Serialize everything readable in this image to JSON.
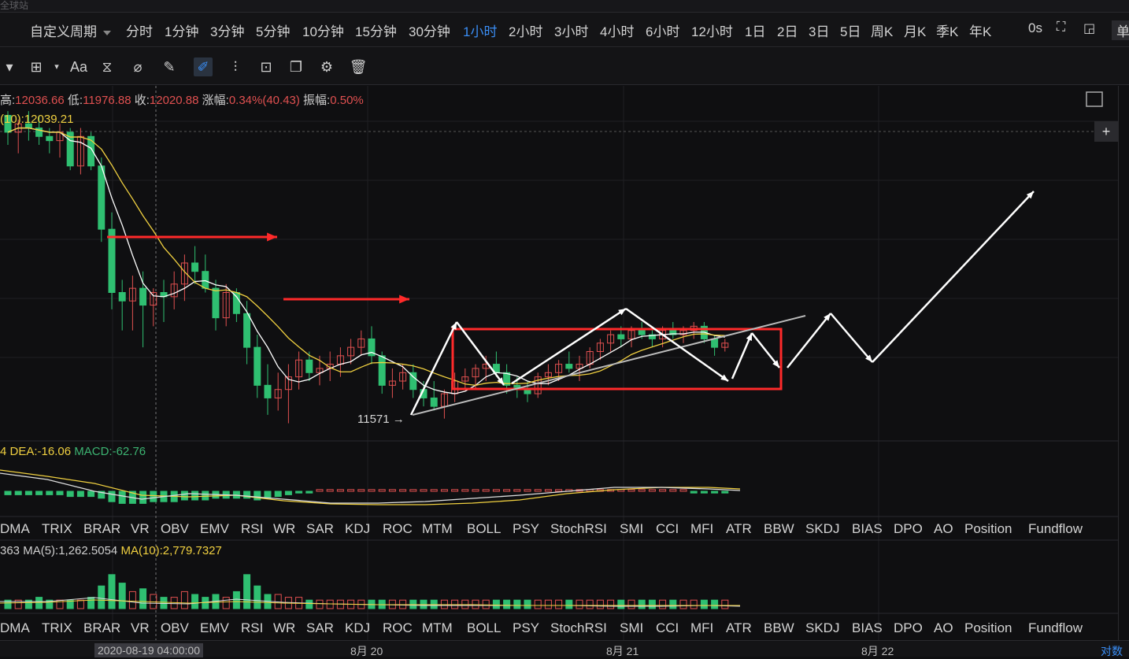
{
  "top_strip": {
    "text": "全球站"
  },
  "period_bar": {
    "custom_label": "自定义周期",
    "periods": [
      "分时",
      "1分钟",
      "3分钟",
      "5分钟",
      "10分钟",
      "15分钟",
      "30分钟",
      "1小时",
      "2小时",
      "3小时",
      "4小时",
      "6小时",
      "12小时",
      "1日",
      "2日",
      "3日",
      "5日",
      "周K",
      "月K",
      "季K",
      "年K"
    ],
    "active_period": "1小时",
    "timer": "0s",
    "right_label": "单"
  },
  "toolbar": {
    "tools": [
      "crosshair-icon",
      "text-icon",
      "pattern-icon",
      "measure-icon",
      "ruler-icon",
      "draw-pen-icon",
      "magnet-icon",
      "lock-icon",
      "copy-icon",
      "settings-icon",
      "trash-icon"
    ],
    "text_tool_label": "Aa",
    "active_tool": "draw-pen-icon"
  },
  "ohlc": {
    "high_label": "高:",
    "high": "12036.66",
    "low_label": "低:",
    "low": "11976.88",
    "close_label": "收:",
    "close": "12020.88",
    "change_label": "涨幅:",
    "change": "0.34%(40.43)",
    "amp_label": "振幅:",
    "amp": "0.50%"
  },
  "ma_line": {
    "label": "(10):",
    "value": "12039.21"
  },
  "price_annotation": {
    "text": "11571 →"
  },
  "macd": {
    "lead": "4",
    "dea_label": "DEA:",
    "dea": "-16.06",
    "macd_label": "MACD:",
    "macd": "-62.76"
  },
  "indicators": [
    "DMA",
    "TRIX",
    "BRAR",
    "VR",
    "OBV",
    "EMV",
    "RSI",
    "WR",
    "SAR",
    "KDJ",
    "ROC",
    "MTM",
    "BOLL",
    "PSY",
    "StochRSI",
    "SMI",
    "CCI",
    "MFI",
    "ATR",
    "BBW",
    "SKDJ",
    "BIAS",
    "DPO",
    "AO",
    "Position",
    "Fundflow"
  ],
  "volume": {
    "lead": "363",
    "ma5_label": "MA(5):",
    "ma5": "1,262.5054",
    "ma10_label": "MA(10):",
    "ma10": "2,779.7327"
  },
  "date_axis": {
    "crosshair_label": "2020-08-19 04:00:00",
    "labels": [
      "8月 20",
      "8月 21",
      "8月 22"
    ],
    "right_label": "对数"
  },
  "colors": {
    "up": "#e05050",
    "down": "#2fbf71",
    "ma5": "#ffffff",
    "ma10": "#f0d040",
    "accent": "#3a8ef5",
    "box": "#ff2a2a"
  },
  "chart_data": {
    "type": "candlestick",
    "title": "",
    "ylim": [
      11520,
      12360
    ],
    "note": "1h candles, approximate OHLC in price units",
    "candles": [
      [
        12290,
        12300,
        12220,
        12250
      ],
      [
        12250,
        12280,
        12200,
        12270
      ],
      [
        12270,
        12300,
        12230,
        12260
      ],
      [
        12260,
        12290,
        12220,
        12240
      ],
      [
        12240,
        12260,
        12200,
        12230
      ],
      [
        12230,
        12270,
        12190,
        12250
      ],
      [
        12250,
        12260,
        12160,
        12170
      ],
      [
        12170,
        12260,
        12150,
        12240
      ],
      [
        12240,
        12250,
        12160,
        12170
      ],
      [
        12170,
        12190,
        11990,
        12020
      ],
      [
        12020,
        12060,
        11830,
        11870
      ],
      [
        11870,
        11900,
        11780,
        11850
      ],
      [
        11850,
        11910,
        11780,
        11880
      ],
      [
        11880,
        11920,
        11740,
        11840
      ],
      [
        11840,
        11880,
        11790,
        11870
      ],
      [
        11870,
        11900,
        11800,
        11860
      ],
      [
        11860,
        11920,
        11830,
        11890
      ],
      [
        11890,
        11960,
        11850,
        11940
      ],
      [
        11940,
        11980,
        11890,
        11920
      ],
      [
        11920,
        11960,
        11870,
        11880
      ],
      [
        11880,
        11900,
        11780,
        11810
      ],
      [
        11810,
        11890,
        11790,
        11870
      ],
      [
        11870,
        11880,
        11800,
        11820
      ],
      [
        11820,
        11850,
        11700,
        11740
      ],
      [
        11740,
        11770,
        11620,
        11650
      ],
      [
        11650,
        11700,
        11580,
        11620
      ],
      [
        11620,
        11680,
        11590,
        11640
      ],
      [
        11640,
        11700,
        11560,
        11670
      ],
      [
        11670,
        11730,
        11640,
        11710
      ],
      [
        11710,
        11730,
        11660,
        11680
      ],
      [
        11680,
        11720,
        11650,
        11690
      ],
      [
        11690,
        11730,
        11660,
        11700
      ],
      [
        11700,
        11740,
        11670,
        11720
      ],
      [
        11720,
        11760,
        11700,
        11740
      ],
      [
        11740,
        11780,
        11720,
        11760
      ],
      [
        11760,
        11790,
        11700,
        11720
      ],
      [
        11720,
        11730,
        11630,
        11650
      ],
      [
        11650,
        11690,
        11620,
        11660
      ],
      [
        11660,
        11700,
        11640,
        11680
      ],
      [
        11680,
        11700,
        11620,
        11640
      ],
      [
        11640,
        11660,
        11600,
        11620
      ],
      [
        11620,
        11660,
        11590,
        11600
      ],
      [
        11600,
        11640,
        11571,
        11630
      ],
      [
        11630,
        11680,
        11610,
        11660
      ],
      [
        11660,
        11690,
        11640,
        11670
      ],
      [
        11670,
        11700,
        11640,
        11690
      ],
      [
        11690,
        11720,
        11660,
        11700
      ],
      [
        11700,
        11730,
        11670,
        11680
      ],
      [
        11680,
        11700,
        11630,
        11650
      ],
      [
        11650,
        11670,
        11620,
        11640
      ],
      [
        11640,
        11660,
        11610,
        11630
      ],
      [
        11630,
        11680,
        11620,
        11670
      ],
      [
        11670,
        11700,
        11650,
        11680
      ],
      [
        11680,
        11710,
        11660,
        11700
      ],
      [
        11700,
        11730,
        11680,
        11690
      ],
      [
        11690,
        11720,
        11660,
        11700
      ],
      [
        11700,
        11740,
        11690,
        11730
      ],
      [
        11730,
        11760,
        11710,
        11750
      ],
      [
        11750,
        11780,
        11730,
        11770
      ],
      [
        11770,
        11790,
        11740,
        11760
      ],
      [
        11760,
        11790,
        11740,
        11780
      ],
      [
        11780,
        11800,
        11760,
        11770
      ],
      [
        11770,
        11790,
        11740,
        11760
      ],
      [
        11760,
        11790,
        11740,
        11780
      ],
      [
        11780,
        11800,
        11760,
        11770
      ],
      [
        11770,
        11790,
        11750,
        11780
      ],
      [
        11780,
        11800,
        11760,
        11790
      ],
      [
        11790,
        11800,
        11750,
        11760
      ],
      [
        11760,
        11770,
        11720,
        11740
      ],
      [
        11740,
        11760,
        11730,
        11750
      ]
    ],
    "volume_histogram": [
      3,
      3,
      3,
      4,
      3,
      3,
      3,
      3,
      4,
      8,
      12,
      9,
      6,
      7,
      5,
      4,
      4,
      6,
      5,
      4,
      5,
      4,
      6,
      12,
      8,
      5,
      5,
      4,
      4,
      3,
      3,
      3,
      3,
      3,
      3,
      3,
      3,
      3,
      3,
      3,
      3,
      3,
      3,
      3,
      3,
      3,
      3,
      3,
      3,
      3,
      3,
      3,
      3,
      3,
      3,
      3,
      3,
      3,
      3,
      3,
      3,
      3,
      3,
      3,
      3,
      3,
      3,
      3,
      3,
      3
    ],
    "macd_histogram": [
      -2,
      -2,
      -2,
      -2,
      -2,
      -2,
      -3,
      -3,
      -3,
      -4,
      -6,
      -7,
      -7,
      -7,
      -6,
      -6,
      -6,
      -5,
      -5,
      -5,
      -4,
      -4,
      -4,
      -4,
      -5,
      -4,
      -3,
      -2,
      -1,
      -1,
      1,
      1,
      1,
      1,
      1,
      1,
      1,
      1,
      1,
      1,
      1,
      1,
      1,
      1,
      1,
      1,
      1,
      1,
      1,
      1,
      1,
      1,
      1,
      1,
      1,
      1,
      1,
      1,
      1,
      1,
      1,
      1,
      1,
      1,
      1,
      1,
      -1,
      -1,
      -1,
      -1
    ]
  }
}
